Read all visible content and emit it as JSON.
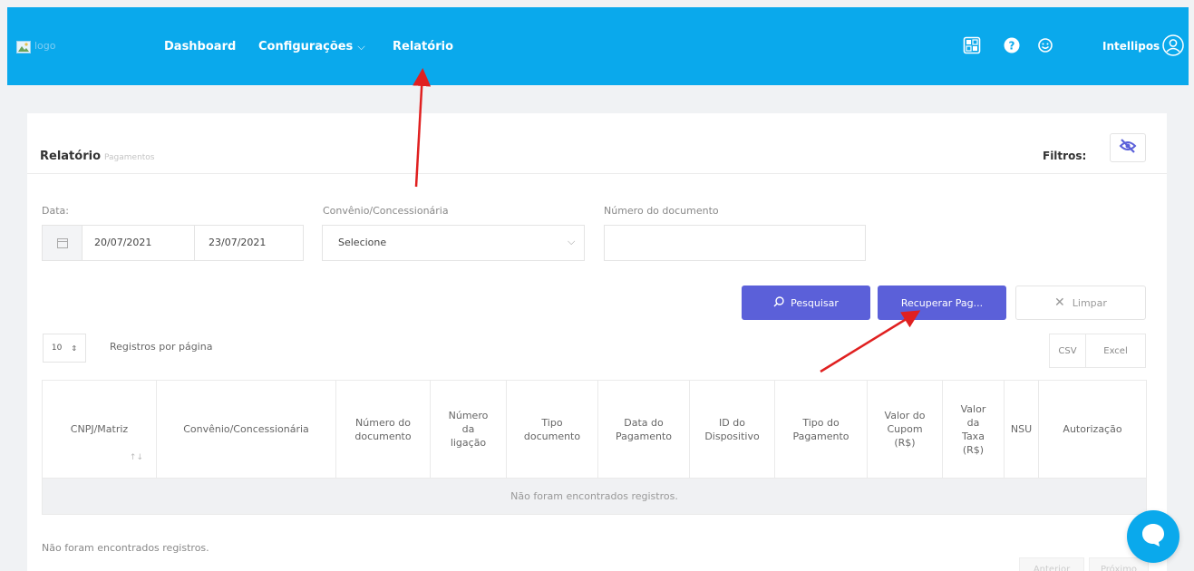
{
  "header": {
    "logo_alt": "logo",
    "nav": {
      "dashboard": "Dashboard",
      "configuracoes": "Configurações",
      "relatorio": "Relatório"
    },
    "user": "Intellipos"
  },
  "card": {
    "title": "Relatório",
    "subtitle": "Pagamentos",
    "filters_label": "Filtros:"
  },
  "form": {
    "date_label": "Data:",
    "date_start": "20/07/2021",
    "date_end": "23/07/2021",
    "convenio_label": "Convênio/Concessionária",
    "convenio_selected": "Selecione",
    "documento_label": "Número do documento",
    "documento_value": ""
  },
  "actions": {
    "pesquisar": "Pesquisar",
    "recuperar": "Recuperar Pag...",
    "limpar": "Limpar"
  },
  "table_controls": {
    "page_size": "10",
    "page_size_label": "Registros por página",
    "csv": "CSV",
    "excel": "Excel"
  },
  "table": {
    "columns": [
      {
        "lines": [
          "CNPJ/Matriz"
        ]
      },
      {
        "lines": [
          "Convênio/Concessionária"
        ]
      },
      {
        "lines": [
          "Número do",
          "documento"
        ]
      },
      {
        "lines": [
          "Número",
          "da",
          "ligação"
        ]
      },
      {
        "lines": [
          "Tipo",
          "documento"
        ]
      },
      {
        "lines": [
          "Data do",
          "Pagamento"
        ]
      },
      {
        "lines": [
          "ID do",
          "Dispositivo"
        ]
      },
      {
        "lines": [
          "Tipo do",
          "Pagamento"
        ]
      },
      {
        "lines": [
          "Valor do",
          "Cupom",
          "(R$)"
        ]
      },
      {
        "lines": [
          "Valor",
          "da",
          "Taxa",
          "(R$)"
        ]
      },
      {
        "lines": [
          "NSU"
        ]
      },
      {
        "lines": [
          "Autorização"
        ]
      }
    ],
    "empty_message": "Não foram encontrados registros."
  },
  "footer": {
    "info": "Não foram encontrados registros.",
    "anterior": "Anterior",
    "proximo": "Próximo"
  },
  "colors": {
    "header_bg": "#0aa9ec",
    "primary": "#5b60d9",
    "annotation_arrow": "#e02020"
  },
  "icons": [
    "help-icon",
    "smiley-icon",
    "user-avatar-icon",
    "calendar-icon",
    "search-icon",
    "close-icon",
    "eye-slash-icon",
    "chat-icon",
    "sort-icon",
    "chevron-down-icon"
  ]
}
